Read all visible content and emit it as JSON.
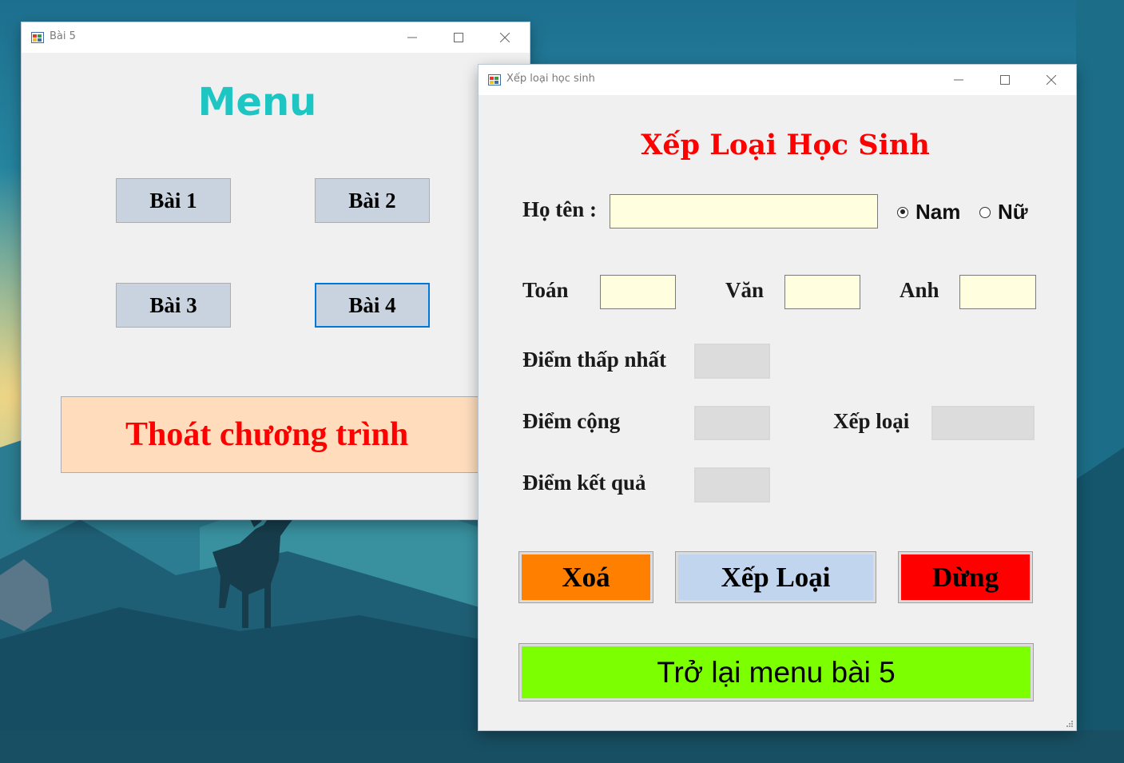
{
  "colors": {
    "menu_title": "#1ec6c3",
    "xl_title": "#ff0000",
    "exit_bg": "#fedcbc",
    "exit_text": "#ff0000",
    "xoa_bg": "#ff8000",
    "xeploai_bg": "#c1d6ee",
    "dung_bg": "#ff0000",
    "back_bg": "#7cff00",
    "input_bg": "#ffffe0",
    "readonly_bg": "#dcdcdc"
  },
  "window_bai5": {
    "title": "Bài 5",
    "heading": "Menu",
    "buttons": [
      "Bài 1",
      "Bài 2",
      "Bài 3",
      "Bài 4"
    ],
    "focused_button": "Bài 4",
    "exit_label": "Thoát chương trình"
  },
  "window_xeploai": {
    "title": "Xếp loại học sinh",
    "heading": "Xếp Loại Học Sinh",
    "name_label": "Họ tên :",
    "name_value": "",
    "gender_options": [
      "Nam",
      "Nữ"
    ],
    "gender_selected": "Nam",
    "subjects": {
      "toan_label": "Toán",
      "van_label": "Văn",
      "anh_label": "Anh"
    },
    "min_score_label": "Điểm thấp nhất",
    "bonus_label": "Điểm cộng",
    "rank_label": "Xếp loại",
    "result_label": "Điểm kết quả",
    "buttons": {
      "clear": "Xoá",
      "rank": "Xếp Loại",
      "stop": "Dừng",
      "back": "Trở lại menu bài 5"
    }
  }
}
